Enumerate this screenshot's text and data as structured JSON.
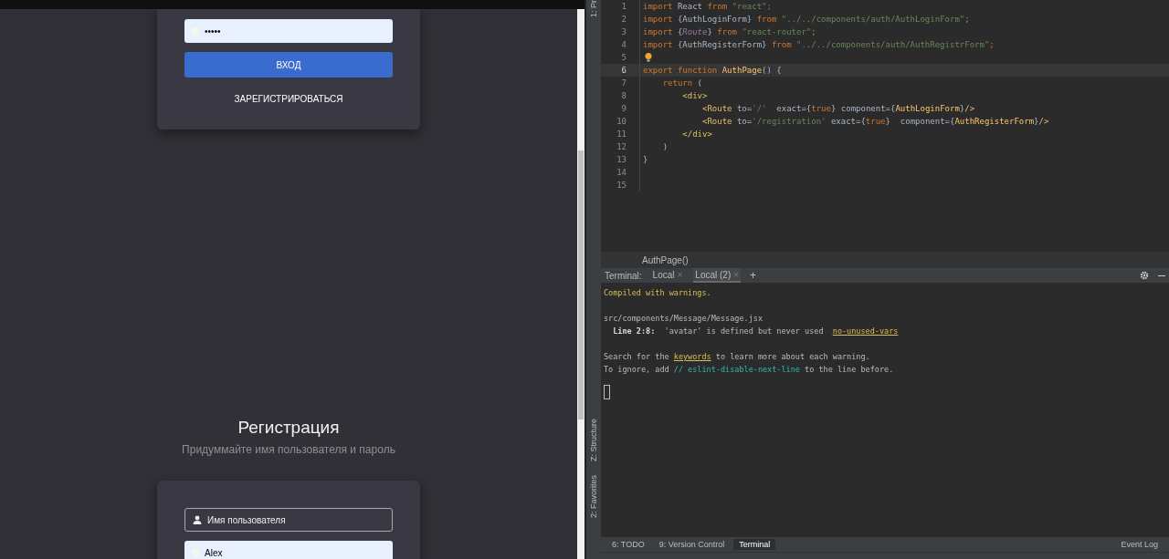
{
  "login_form": {
    "password_value": "•••••",
    "submit_button": "ВХОД",
    "register_link": "ЗАРЕГИСТРИРОВАТЬСЯ"
  },
  "registration": {
    "title": "Регистрация",
    "subtitle": "Придуммайте имя пользователя и пароль",
    "username_placeholder": "Имя пользователя",
    "second_field_value": "Alex"
  },
  "tool_strip": [
    {
      "label": "1: Pr"
    },
    {
      "label": "Z: Structure"
    },
    {
      "label": "2: Favorites"
    }
  ],
  "editor": {
    "lines": [
      {
        "number": "1",
        "current": false,
        "tokens": [
          {
            "kind": "kw",
            "text": "import "
          },
          {
            "kind": "plain",
            "text": "React "
          },
          {
            "kind": "kw",
            "text": "from "
          },
          {
            "kind": "str",
            "text": "\"react\";"
          }
        ]
      },
      {
        "number": "2",
        "current": false,
        "tokens": [
          {
            "kind": "kw",
            "text": "import "
          },
          {
            "kind": "plain",
            "text": "{AuthLoginForm} "
          },
          {
            "kind": "kw",
            "text": "from "
          },
          {
            "kind": "str",
            "text": "\"../../components/auth/AuthLoginForm\""
          },
          {
            "kind": "kw",
            "text": ";"
          }
        ]
      },
      {
        "number": "3",
        "current": false,
        "tokens": [
          {
            "kind": "kw",
            "text": "import "
          },
          {
            "kind": "plain",
            "text": "{"
          },
          {
            "kind": "em",
            "text": "Route"
          },
          {
            "kind": "plain",
            "text": "} "
          },
          {
            "kind": "kw",
            "text": "from "
          },
          {
            "kind": "str",
            "text": "\"react-router\""
          },
          {
            "kind": "kw",
            "text": ";"
          }
        ]
      },
      {
        "number": "4",
        "current": false,
        "tokens": [
          {
            "kind": "kw",
            "text": "import "
          },
          {
            "kind": "plain",
            "text": "{AuthRegisterForm} "
          },
          {
            "kind": "kw",
            "text": "from "
          },
          {
            "kind": "str",
            "text": "\"../../components/auth/AuthRegistrForm\""
          },
          {
            "kind": "kw",
            "text": ";"
          }
        ]
      },
      {
        "number": "5",
        "current": false
      },
      {
        "number": "6",
        "current": true,
        "tokens": [
          {
            "kind": "kw",
            "text": "export function "
          },
          {
            "kind": "fn",
            "text": "AuthPage"
          },
          {
            "kind": "plain",
            "text": "() {"
          }
        ]
      },
      {
        "number": "7",
        "current": false,
        "tokens": [
          {
            "kind": "kw",
            "text": "    return "
          },
          {
            "kind": "plain",
            "text": "("
          }
        ]
      },
      {
        "number": "8",
        "current": false,
        "tokens": [
          {
            "kind": "tag",
            "text": "        <div>"
          }
        ]
      },
      {
        "number": "9",
        "current": false,
        "tokens": [
          {
            "kind": "tag",
            "text": "            <Route "
          },
          {
            "kind": "plain",
            "text": "to="
          },
          {
            "kind": "str",
            "text": "'/'"
          },
          {
            "kind": "plain",
            "text": "  exact={"
          },
          {
            "kind": "kw",
            "text": "true"
          },
          {
            "kind": "plain",
            "text": "} component={"
          },
          {
            "kind": "fn",
            "text": "AuthLoginForm"
          },
          {
            "kind": "plain",
            "text": "}"
          },
          {
            "kind": "tag",
            "text": "/>"
          }
        ]
      },
      {
        "number": "10",
        "current": false,
        "tokens": [
          {
            "kind": "tag",
            "text": "            <Route "
          },
          {
            "kind": "plain",
            "text": "to="
          },
          {
            "kind": "str",
            "text": "'/registration'"
          },
          {
            "kind": "plain",
            "text": " exact={"
          },
          {
            "kind": "kw",
            "text": "true"
          },
          {
            "kind": "plain",
            "text": "}  component={"
          },
          {
            "kind": "fn",
            "text": "AuthRegisterForm"
          },
          {
            "kind": "plain",
            "text": "}"
          },
          {
            "kind": "tag",
            "text": "/>"
          }
        ]
      },
      {
        "number": "11",
        "current": false,
        "tokens": [
          {
            "kind": "tag",
            "text": "        </div>"
          }
        ]
      },
      {
        "number": "12",
        "current": false,
        "tokens": [
          {
            "kind": "plain",
            "text": "    )"
          }
        ]
      },
      {
        "number": "13",
        "current": false,
        "tokens": [
          {
            "kind": "plain",
            "text": "}"
          }
        ]
      },
      {
        "number": "14",
        "current": false
      },
      {
        "number": "15",
        "current": false
      }
    ],
    "breadcrumb": "AuthPage()"
  },
  "terminal": {
    "label": "Terminal:",
    "tabs": [
      {
        "label": "Local",
        "close": "×",
        "selected": false
      },
      {
        "label": "Local (2)",
        "close": "×",
        "selected": true
      }
    ],
    "add_button": "+",
    "lines": [
      {
        "gap_before": false,
        "tokens": [
          {
            "kind": "warn",
            "text": "Compiled with warnings."
          }
        ]
      },
      {
        "gap_before": true,
        "tokens": [
          {
            "kind": "plain",
            "text": "src/components/Message/Message.jsx"
          }
        ]
      },
      {
        "gap_before": false,
        "tokens": [
          {
            "kind": "bold",
            "text": "  Line 2:8:"
          },
          {
            "kind": "plain",
            "text": "  'avatar' is defined but never used  "
          },
          {
            "kind": "link",
            "text": "no-unused-vars"
          }
        ]
      },
      {
        "gap_before": true,
        "tokens": [
          {
            "kind": "plain",
            "text": "Search for the "
          },
          {
            "kind": "link",
            "text": "keywords"
          },
          {
            "kind": "plain",
            "text": " to learn more about each warning."
          }
        ]
      },
      {
        "gap_before": false,
        "tokens": [
          {
            "kind": "plain",
            "text": "To ignore, add "
          },
          {
            "kind": "comment",
            "text": "// eslint-disable-next-line"
          },
          {
            "kind": "plain",
            "text": " to the line before."
          }
        ]
      }
    ]
  },
  "tool_windows": [
    {
      "label": "6: TODO",
      "selected": false
    },
    {
      "label": "9: Version Control",
      "selected": false
    },
    {
      "label": "Terminal",
      "selected": true
    }
  ],
  "event_log": "Event Log"
}
